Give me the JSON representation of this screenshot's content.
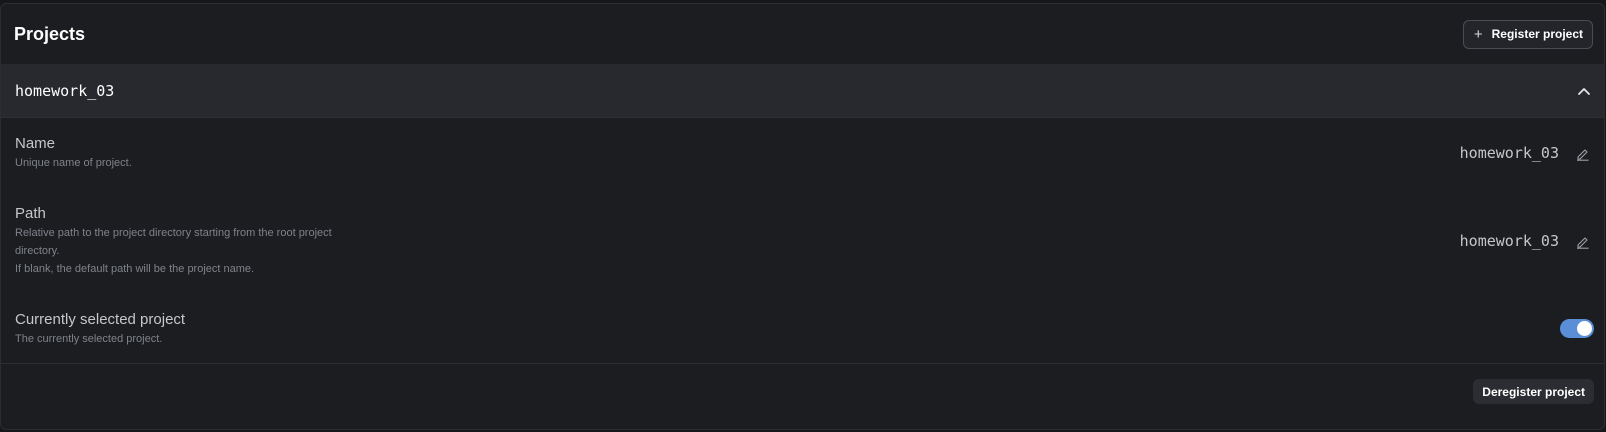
{
  "header": {
    "title": "Projects",
    "register_label": "Register project"
  },
  "project": {
    "title": "homework_03",
    "expanded": true,
    "settings": {
      "name": {
        "label": "Name",
        "description": "Unique name of project.",
        "value": "homework_03"
      },
      "path": {
        "label": "Path",
        "description_lines": [
          "Relative path to the project directory starting from the root project directory.",
          "If blank, the default path will be the project name."
        ],
        "value": "homework_03"
      },
      "selected": {
        "label": "Currently selected project",
        "description": "The currently selected project.",
        "enabled": true
      }
    },
    "deregister_label": "Deregister project"
  },
  "colors": {
    "panel_bg": "#1c1d21",
    "project_header_bg": "#27292f",
    "toggle_on": "#5a8fd8",
    "muted_text": "#7f828a"
  },
  "icons": [
    "plus-icon",
    "chevron-up-icon",
    "pencil-icon"
  ]
}
